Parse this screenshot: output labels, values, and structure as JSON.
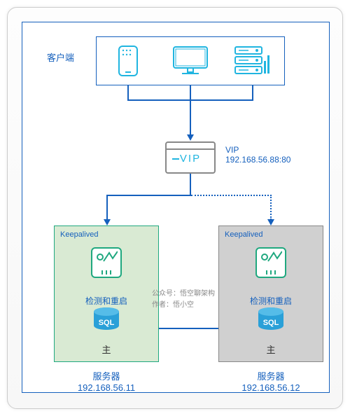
{
  "labels": {
    "client": "客户端",
    "vip_word": "VIP",
    "vip_title": "VIP",
    "vip_addr": "192.168.56.88:80",
    "keepalived": "Keepalived",
    "check_and_restart": "检测和重启",
    "sql": "SQL",
    "role_master": "主",
    "server": "服务器"
  },
  "servers": [
    {
      "ip": "192.168.56.11",
      "role": "主"
    },
    {
      "ip": "192.168.56.12",
      "role": "主"
    }
  ],
  "credit": {
    "line1": "公众号：悟空聊架构",
    "line2": "作者：悟小空"
  }
}
